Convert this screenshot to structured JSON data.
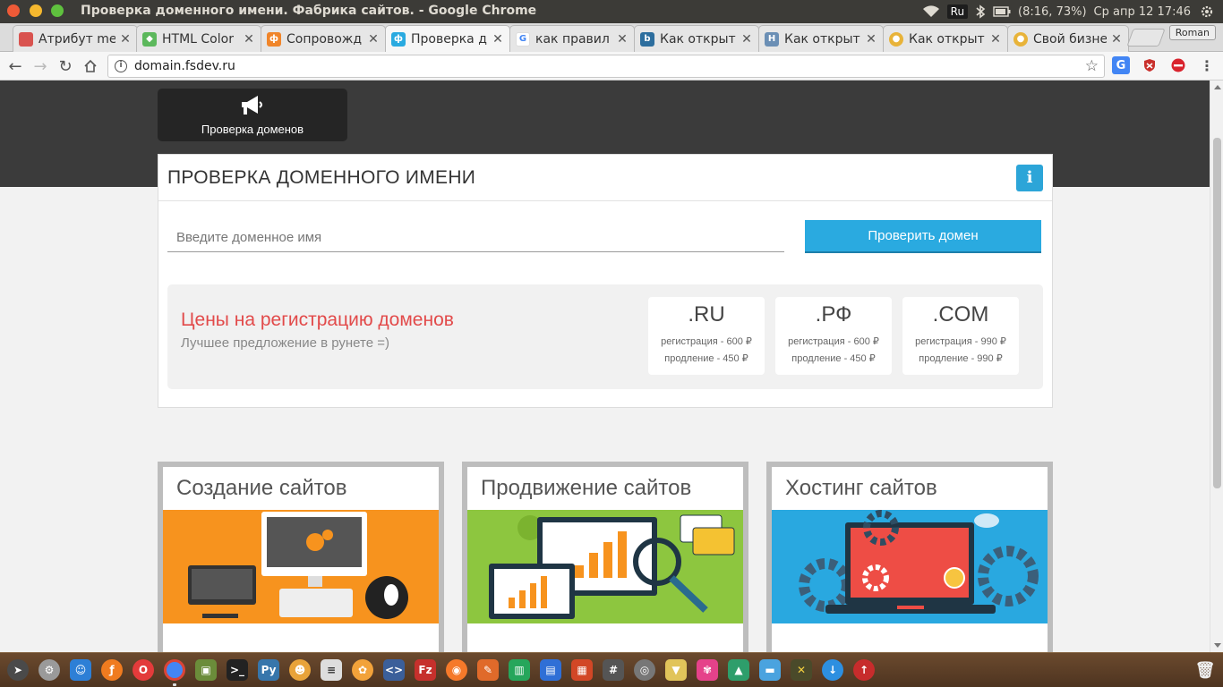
{
  "window": {
    "title": "Проверка доменного имени. Фабрика сайтов. - Google Chrome",
    "keyboard_layout": "Ru",
    "battery": "(8:16, 73%)",
    "datetime": "Ср апр 12 17:46"
  },
  "tabs": [
    {
      "title": "Атрибут me",
      "favicon": "red-square-icon",
      "color": "#d9534f"
    },
    {
      "title": "HTML Color",
      "favicon": "green-code-icon",
      "color": "#5cb85c"
    },
    {
      "title": "Сопровожд",
      "favicon": "orange-f-icon",
      "color": "#f0852a"
    },
    {
      "title": "Проверка д",
      "favicon": "blue-f-icon",
      "color": "#2aaae0",
      "active": true
    },
    {
      "title": "как правил",
      "favicon": "google-icon",
      "color": "#4285f4"
    },
    {
      "title": "Как открыт",
      "favicon": "blog-icon",
      "color": "#2d6e9e"
    },
    {
      "title": "Как открыт",
      "favicon": "h-icon",
      "color": "#6b8fb5"
    },
    {
      "title": "Как открыт",
      "favicon": "yellow-circle-icon",
      "color": "#e8b339"
    },
    {
      "title": "Свой бизне",
      "favicon": "yellow-circle-icon",
      "color": "#e8b339"
    }
  ],
  "profile_name": "Roman",
  "address": {
    "url": "domain.fsdev.ru"
  },
  "page": {
    "nav_pill_label": "Проверка доменов",
    "card_title": "ПРОВЕРКА ДОМЕННОГО ИМЕНИ",
    "input_placeholder": "Введите доменное имя",
    "check_button": "Проверить домен",
    "prices_title": "Цены на регистрацию доменов",
    "prices_subtitle": "Лучшее предложение в рунете =)",
    "zones": [
      {
        "name": ".RU",
        "registration": "регистрация - 600 ₽",
        "renewal": "продление - 450 ₽"
      },
      {
        "name": ".РФ",
        "registration": "регистрация - 600 ₽",
        "renewal": "продление - 450 ₽"
      },
      {
        "name": ".COM",
        "registration": "регистрация - 990 ₽",
        "renewal": "продление - 990 ₽"
      }
    ],
    "services": [
      {
        "title": "Создание сайтов",
        "banner_color": "#f7931e"
      },
      {
        "title": "Продвижение сайтов",
        "banner_color": "#8dc63f"
      },
      {
        "title": "Хостинг сайтов",
        "banner_color": "#29a8e0"
      }
    ]
  },
  "colors": {
    "accent_blue": "#2aaae0",
    "price_title_red": "#e24a4a",
    "header_dark": "#3b3b3b"
  }
}
